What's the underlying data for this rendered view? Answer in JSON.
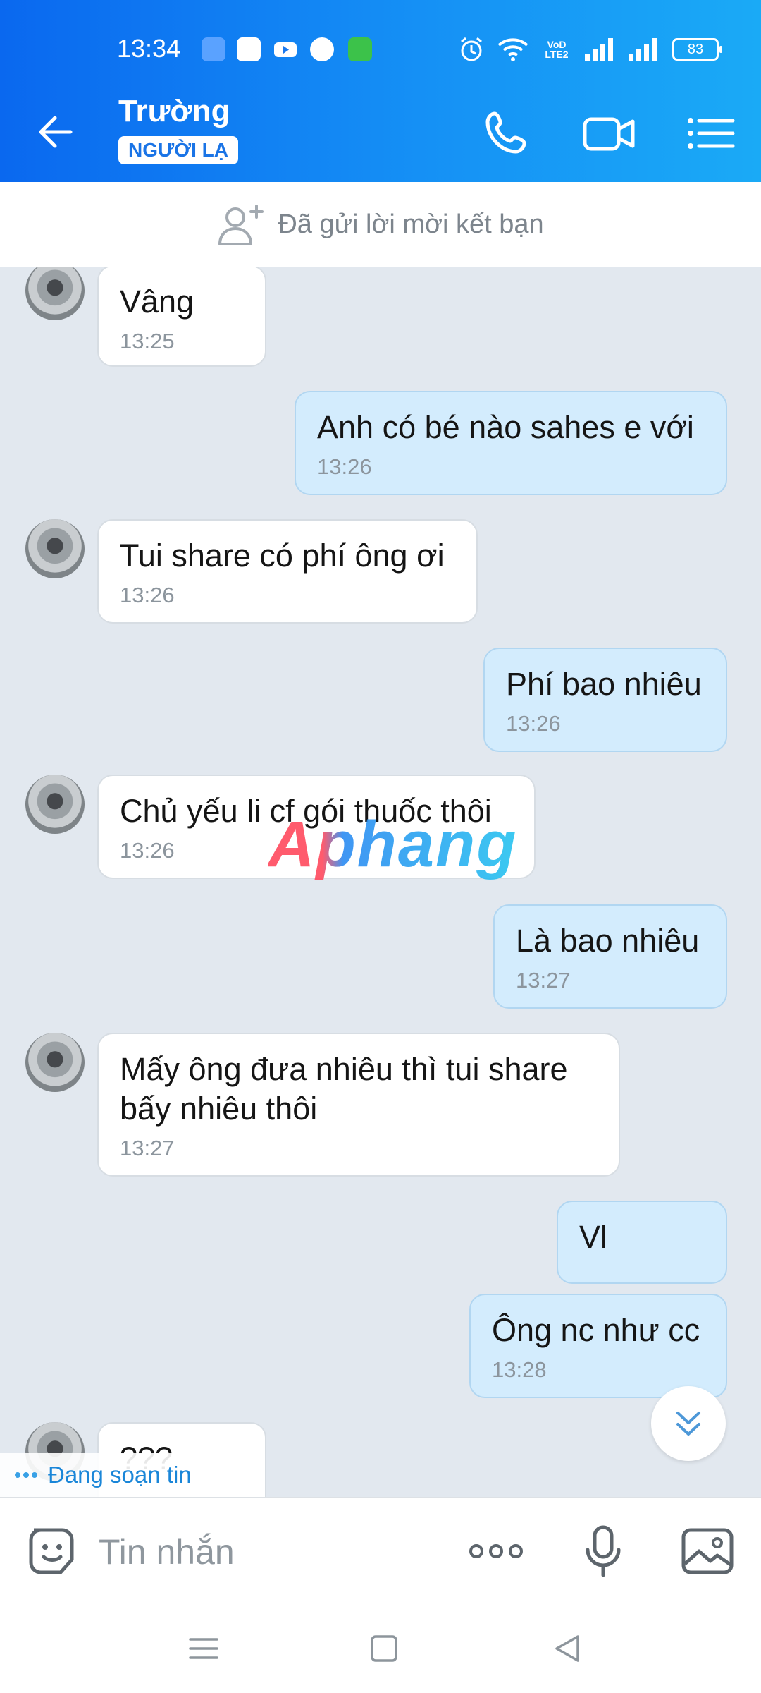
{
  "status_bar": {
    "time": "13:34",
    "network_label": "VoD LTE2",
    "battery": "83"
  },
  "header": {
    "contact_name": "Trường",
    "badge": "NGƯỜI LẠ",
    "icons": [
      "back-arrow-icon",
      "phone-icon",
      "video-call-icon",
      "menu-list-icon"
    ]
  },
  "friend_request": {
    "text": "Đã gửi lời mời kết bạn"
  },
  "messages": [
    {
      "from": "them",
      "text": "Vâng",
      "time": "13:25"
    },
    {
      "from": "me",
      "text": "Anh có bé nào sahes e với",
      "time": "13:26"
    },
    {
      "from": "them",
      "text": "Tui share có phí ông ơi",
      "time": "13:26"
    },
    {
      "from": "me",
      "text": "Phí bao nhiêu",
      "time": "13:26"
    },
    {
      "from": "them",
      "text": "Chủ yếu li cf gói thuốc thôi",
      "time": "13:26"
    },
    {
      "from": "me",
      "text": "Là bao nhiêu",
      "time": "13:27"
    },
    {
      "from": "them",
      "text": "Mấy ông đưa nhiêu thì tui share bấy nhiêu thôi",
      "time": "13:27"
    },
    {
      "from": "me",
      "text": "Vl",
      "time": ""
    },
    {
      "from": "me",
      "text": "Ông nc như cc",
      "time": "13:28"
    },
    {
      "from": "them",
      "text": "???",
      "time": ""
    }
  ],
  "watermark": "Aphang",
  "typing_indicator": "Đang soạn tin",
  "composer": {
    "placeholder": "Tin nhắn"
  },
  "colors": {
    "header_start": "#0a68ef",
    "header_end": "#1aaaf6",
    "outgoing_bubble": "#d3ecfd",
    "incoming_bubble": "#ffffff",
    "chat_background": "#e2e8ef"
  }
}
